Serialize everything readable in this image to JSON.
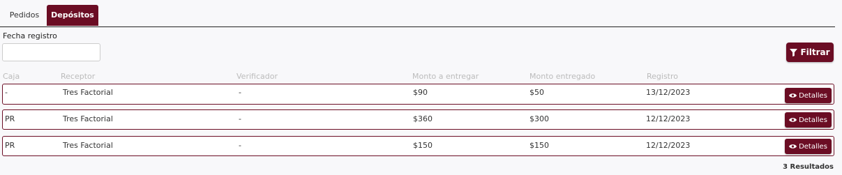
{
  "tabs": [
    {
      "label": "Pedidos",
      "active": false
    },
    {
      "label": "Depósitos",
      "active": true
    }
  ],
  "filter": {
    "date_label": "Fecha registro",
    "date_value": "",
    "button_label": "Filtrar"
  },
  "table": {
    "columns": [
      "Caja",
      "Receptor",
      "Verificador",
      "Monto a entregar",
      "Monto entregado",
      "Registro"
    ],
    "rows": [
      {
        "caja": "-",
        "receptor": "Tres Factorial",
        "verificador": "-",
        "monto_a_entregar": "$90",
        "monto_entregado": "$50",
        "registro": "13/12/2023",
        "action": "Detalles"
      },
      {
        "caja": "PR",
        "receptor": "Tres Factorial",
        "verificador": "-",
        "monto_a_entregar": "$360",
        "monto_entregado": "$300",
        "registro": "12/12/2023",
        "action": "Detalles"
      },
      {
        "caja": "PR",
        "receptor": "Tres Factorial",
        "verificador": "-",
        "monto_a_entregar": "$150",
        "monto_entregado": "$150",
        "registro": "12/12/2023",
        "action": "Detalles"
      }
    ]
  },
  "results_text": "3 Resultados",
  "colors": {
    "accent": "#6b0d24",
    "background": "#f8f8fa"
  },
  "icons": {
    "filter": "filter-icon",
    "details": "eye-icon"
  }
}
